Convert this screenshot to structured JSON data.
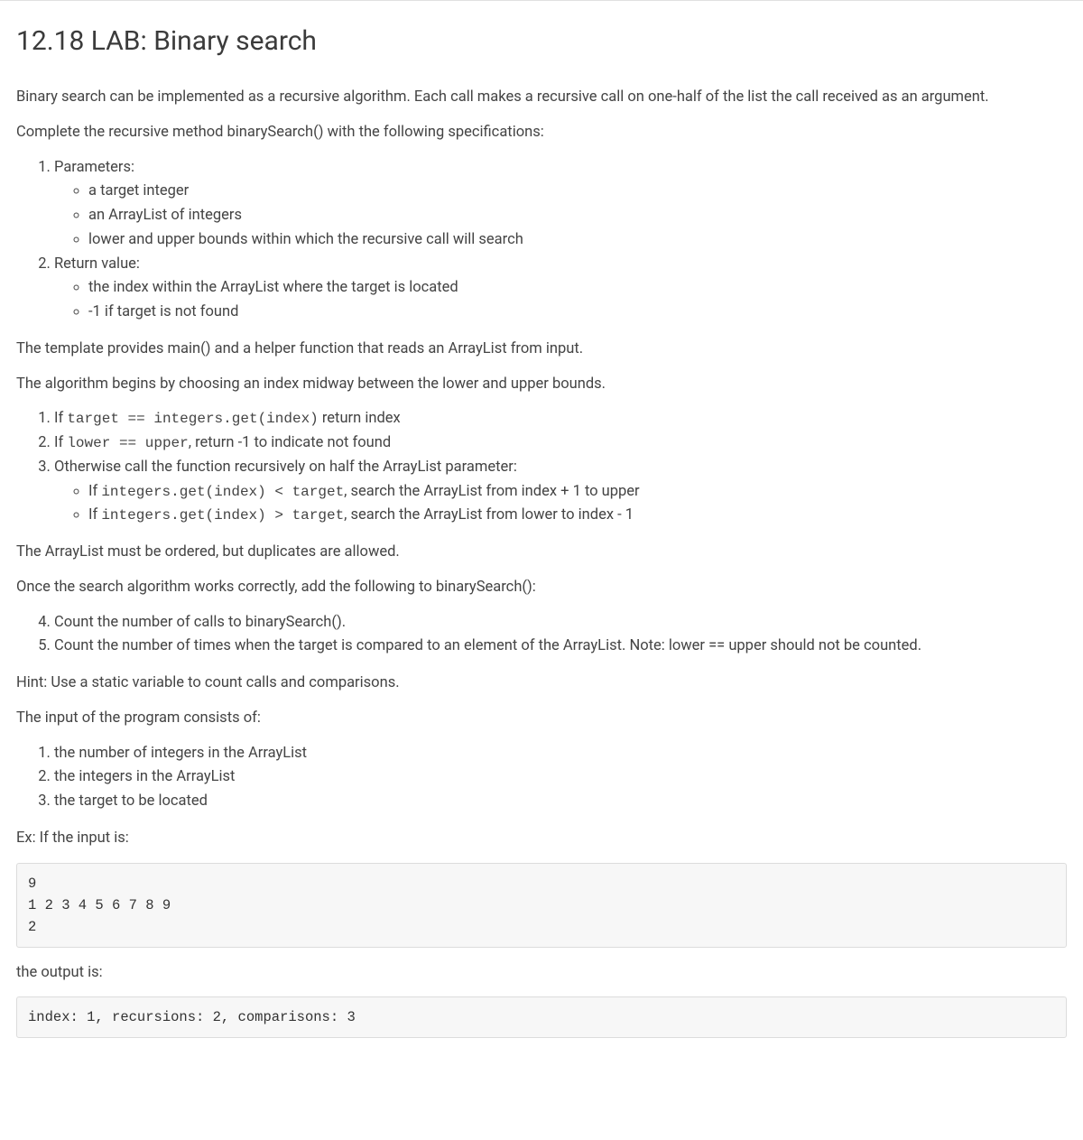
{
  "title": "12.18 LAB: Binary search",
  "intro_p1": "Binary search can be implemented as a recursive algorithm. Each call makes a recursive call on one-half of the list the call received as an argument.",
  "intro_p2": "Complete the recursive method binarySearch() with the following specifications:",
  "spec_list": {
    "item1": {
      "label": "Parameters:",
      "bullets": [
        "a target integer",
        "an ArrayList of integers",
        "lower and upper bounds within which the recursive call will search"
      ]
    },
    "item2": {
      "label": "Return value:",
      "bullets": [
        "the index within the ArrayList where the target is located",
        "-1 if target is not found"
      ]
    }
  },
  "template_p": "The template provides main() and a helper function that reads an ArrayList from input.",
  "algo_intro": "The algorithm begins by choosing an index midway between the lower and upper bounds.",
  "algo_steps": {
    "s1": {
      "prefix": "If ",
      "code": "target == integers.get(index)",
      "suffix": " return index"
    },
    "s2": {
      "prefix": "If ",
      "code": "lower == upper",
      "suffix": ", return -1 to indicate not found"
    },
    "s3": {
      "label": "Otherwise call the function recursively on half the ArrayList parameter:",
      "bullets": {
        "b1": {
          "prefix": "If ",
          "code": "integers.get(index) < target",
          "suffix": ", search the ArrayList from index + 1 to upper"
        },
        "b2": {
          "prefix": "If ",
          "code": "integers.get(index) > target",
          "suffix": ", search the ArrayList from lower to index - 1"
        }
      }
    }
  },
  "ordered_p": "The ArrayList must be ordered, but duplicates are allowed.",
  "once_works_p": "Once the search algorithm works correctly, add the following to binarySearch():",
  "count_steps": {
    "s4": "Count the number of calls to binarySearch().",
    "s5": "Count the number of times when the target is compared to an element of the ArrayList. Note: lower == upper should not be counted."
  },
  "hint_p": "Hint: Use a static variable to count calls and comparisons.",
  "input_intro": "The input of the program consists of:",
  "input_items": [
    "the number of integers in the ArrayList",
    "the integers in the ArrayList",
    "the target to be located"
  ],
  "example_label": "Ex: If the input is:",
  "example_input": "9\n1 2 3 4 5 6 7 8 9\n2",
  "output_label": "the output is:",
  "example_output": "index: 1, recursions: 2, comparisons: 3"
}
